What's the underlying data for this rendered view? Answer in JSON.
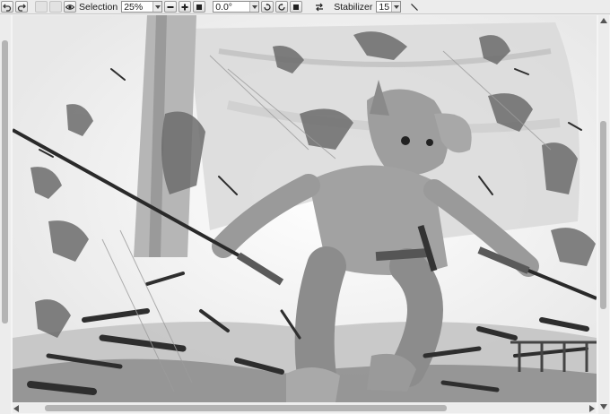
{
  "toolbar": {
    "undo_icon": "undo-icon",
    "redo_icon": "redo-icon",
    "selection_label": "Selection",
    "zoom_value": "25%",
    "angle_value": "0.0°",
    "stabilizer_label": "Stabilizer",
    "stabilizer_value": "15"
  },
  "canvas": {
    "description_colors": {
      "paper": "#ffffff",
      "sail": "#d8d8d8",
      "figure": "#9a9a9a",
      "ink": "#2a2a2a"
    }
  }
}
